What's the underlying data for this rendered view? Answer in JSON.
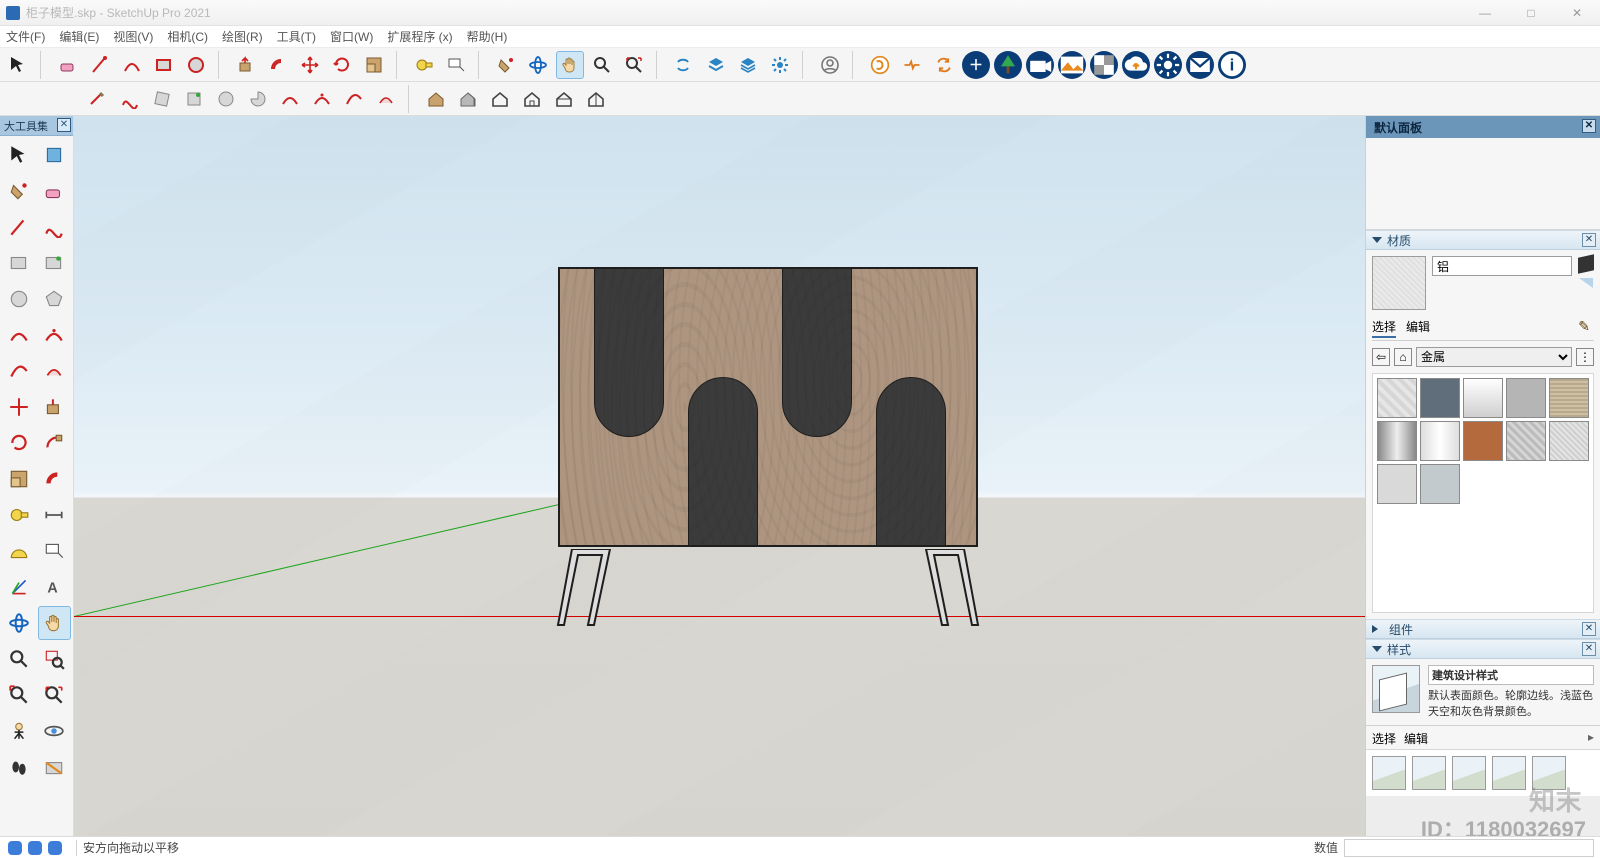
{
  "title": "柜子模型.skp - SketchUp Pro 2021",
  "window": {
    "min": "—",
    "max": "□",
    "close": "✕"
  },
  "menus": [
    "文件(F)",
    "编辑(E)",
    "视图(V)",
    "相机(C)",
    "绘图(R)",
    "工具(T)",
    "窗口(W)",
    "扩展程序 (x)",
    "帮助(H)"
  ],
  "left_palette": {
    "title": "大工具集"
  },
  "tray": {
    "title": "默认面板",
    "sections": {
      "materials": {
        "label": "材质",
        "name_value": "铝",
        "tabs": [
          "选择",
          "编辑"
        ],
        "category": "金属"
      },
      "components": {
        "label": "组件"
      },
      "styles": {
        "label": "样式",
        "name": "建筑设计样式",
        "desc": "默认表面颜色。轮廓边线。浅蓝色天空和灰色背景颜色。",
        "tabs": [
          "选择",
          "编辑"
        ]
      }
    }
  },
  "status": {
    "hint": "安方向拖动以平移",
    "value_label": "数值"
  },
  "watermark": {
    "brand": "知末",
    "id": "ID：1180032697"
  }
}
